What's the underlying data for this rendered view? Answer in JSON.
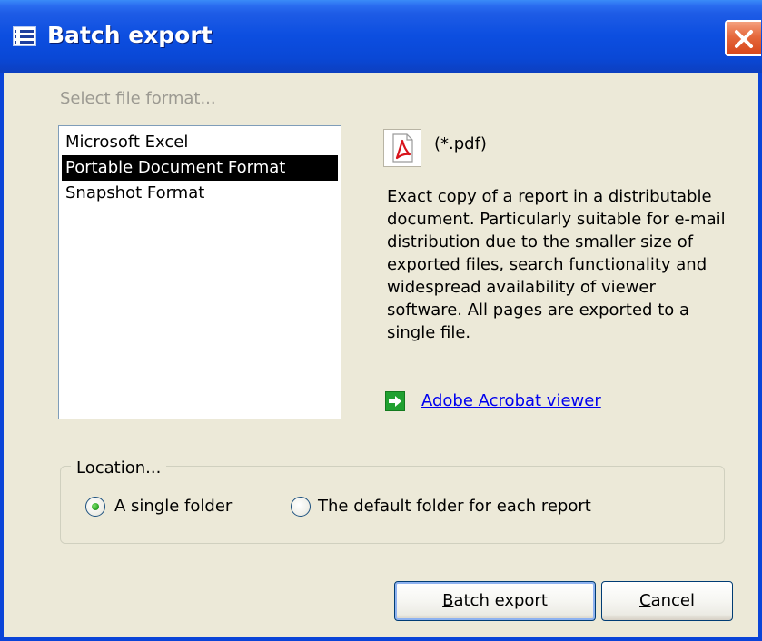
{
  "window": {
    "title": "Batch export"
  },
  "format_section": {
    "prompt": "Select file format...",
    "options": [
      {
        "label": "Microsoft Excel",
        "selected": false
      },
      {
        "label": "Portable Document Format",
        "selected": true
      },
      {
        "label": "Snapshot Format",
        "selected": false
      }
    ]
  },
  "details": {
    "extension": "(*.pdf)",
    "description": "Exact copy of a report in a distributable document. Particularly suitable for e-mail distribution due to the smaller size of exported files, search functionality and widespread availability of viewer software. All pages are exported to a single file.",
    "viewer_link": "Adobe Acrobat viewer",
    "icons": {
      "format": "pdf-icon",
      "link": "green-arrow-icon"
    }
  },
  "location": {
    "legend": "Location...",
    "options": [
      {
        "label": "A single folder",
        "checked": true
      },
      {
        "label": "The default folder for each report",
        "checked": false
      }
    ]
  },
  "buttons": {
    "primary": {
      "mnemonic": "B",
      "rest": "atch export"
    },
    "cancel": {
      "mnemonic": "C",
      "rest": "ancel"
    }
  },
  "colors": {
    "titlebar": "#0a48d6",
    "dialog_bg": "#ece9d8",
    "close_button": "#e5683c",
    "link": "#0000ee",
    "selection_bg": "#000000"
  }
}
